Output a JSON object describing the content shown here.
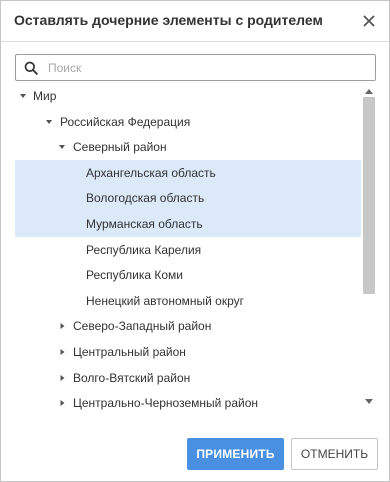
{
  "dialog": {
    "title": "Оставлять дочерние элементы с родителем",
    "close_icon": "close-icon"
  },
  "search": {
    "placeholder": "Поиск",
    "value": "",
    "icon": "search-icon"
  },
  "tree": {
    "items": [
      {
        "label": "Мир",
        "level": 0,
        "arrow": "expanded",
        "selected": false
      },
      {
        "label": "Российская Федерация",
        "level": 1,
        "arrow": "expanded",
        "selected": false
      },
      {
        "label": "Северный район",
        "level": 2,
        "arrow": "expanded",
        "selected": false
      },
      {
        "label": "Архангельская область",
        "level": 3,
        "arrow": "none",
        "selected": true
      },
      {
        "label": "Вологодская область",
        "level": 3,
        "arrow": "none",
        "selected": true
      },
      {
        "label": "Мурманская область",
        "level": 3,
        "arrow": "none",
        "selected": true
      },
      {
        "label": "Республика Карелия",
        "level": 3,
        "arrow": "none",
        "selected": false
      },
      {
        "label": "Республика Коми",
        "level": 3,
        "arrow": "none",
        "selected": false
      },
      {
        "label": "Ненецкий автономный округ",
        "level": 3,
        "arrow": "none",
        "selected": false
      },
      {
        "label": "Северо-Западный район",
        "level": 2,
        "arrow": "collapsed",
        "selected": false
      },
      {
        "label": "Центральный район",
        "level": 2,
        "arrow": "collapsed",
        "selected": false
      },
      {
        "label": "Волго-Вятский район",
        "level": 2,
        "arrow": "collapsed",
        "selected": false
      },
      {
        "label": "Центрально-Черноземный район",
        "level": 2,
        "arrow": "collapsed",
        "selected": false
      }
    ]
  },
  "buttons": {
    "apply_label": "ПРИМЕНИТЬ",
    "cancel_label": "ОТМЕНИТЬ"
  },
  "colors": {
    "selection": "#dce9f9",
    "primary": "#4a90e2",
    "scroll_thumb": "#c7c7c7"
  }
}
